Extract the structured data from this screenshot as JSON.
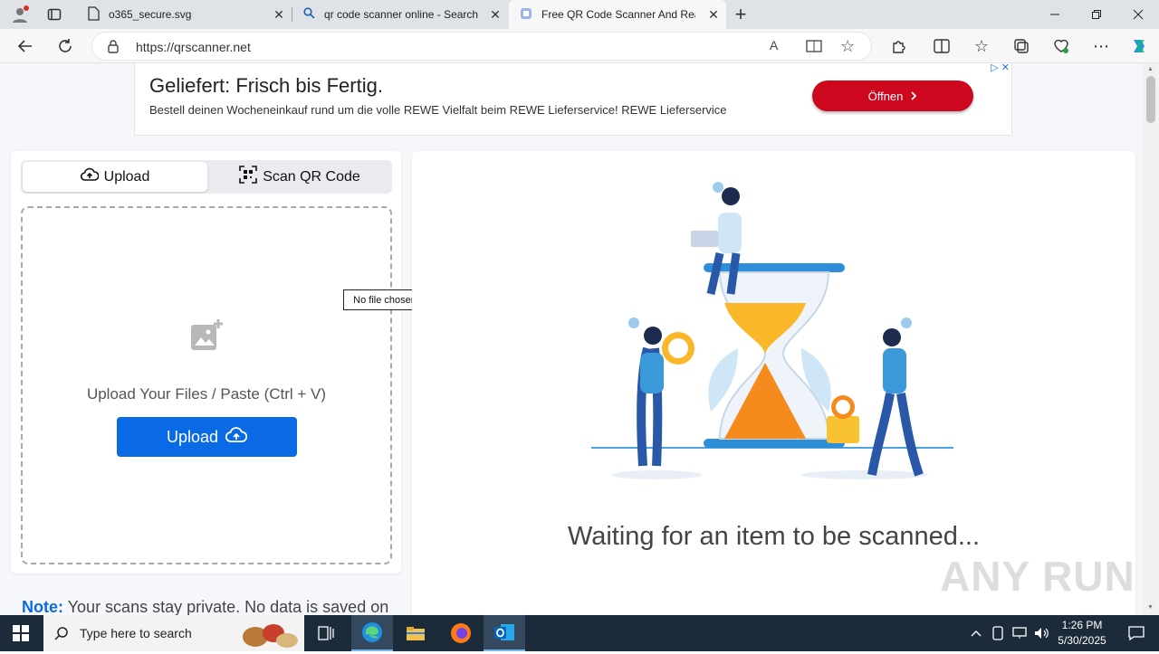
{
  "browser": {
    "tabs": [
      {
        "title": "o365_secure.svg",
        "icon": "file-icon",
        "active": false
      },
      {
        "title": "qr code scanner online - Search",
        "icon": "search-icon",
        "active": false
      },
      {
        "title": "Free QR Code Scanner And Read",
        "icon": "qr-site-icon",
        "active": true
      }
    ],
    "url": "https://qrscanner.net"
  },
  "ad": {
    "headline": "Geliefert: Frisch bis Fertig.",
    "text": "Bestell deinen Wocheneinkauf rund um die volle REWE Vielfalt beim REWE Lieferservice! REWE Lieferservice",
    "button": "Öffnen",
    "colors": {
      "button": "#cc071e"
    }
  },
  "scanner": {
    "tab_upload": "Upload",
    "tab_scan": "Scan QR Code",
    "drop_hint": "Upload Your Files / Paste (Ctrl + V)",
    "upload_button": "Upload",
    "file_tooltip": "No file chosen",
    "note_label": "Note:",
    "note_text": "Your scans stay private. No data is saved on",
    "waiting": "Waiting for an item to be scanned...",
    "colors": {
      "primary": "#0a6ae6"
    }
  },
  "watermark": "ANY RUN",
  "taskbar": {
    "search_placeholder": "Type here to search",
    "time": "1:26 PM",
    "date": "5/30/2025"
  }
}
